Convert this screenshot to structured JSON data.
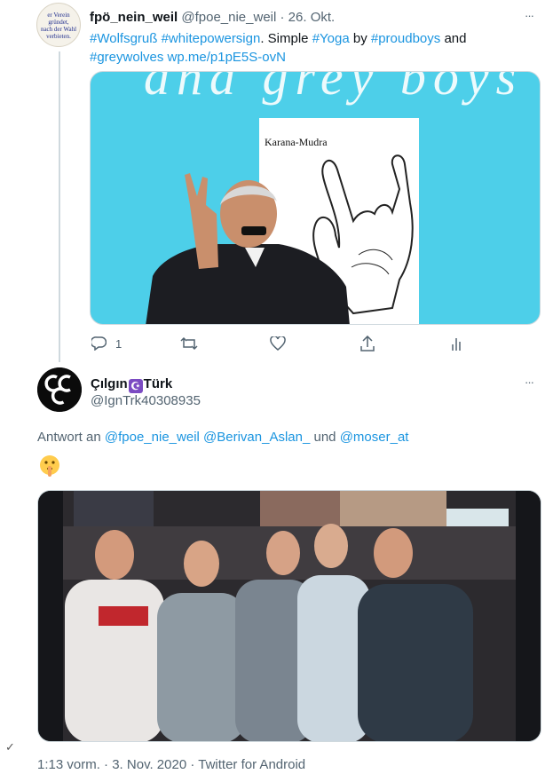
{
  "tweet1": {
    "avatar_lines": [
      "er Verein",
      "gründet,",
      "nach der Wahl",
      "verbieten."
    ],
    "display_name": "fpö_nein_weil",
    "handle": "@fpoe_nie_weil",
    "separator": "·",
    "date": "26. Okt.",
    "more_icon": "···",
    "text_parts": [
      {
        "t": "#Wolfsgruß",
        "link": true
      },
      {
        "t": " ",
        "link": false
      },
      {
        "t": "#whitepowersign",
        "link": true
      },
      {
        "t": ". Simple ",
        "link": false
      },
      {
        "t": "#Yoga",
        "link": true
      },
      {
        "t": " by ",
        "link": false
      },
      {
        "t": "#proudboys",
        "link": true
      },
      {
        "t": " and ",
        "link": false
      },
      {
        "t": "#greywolves",
        "link": true
      },
      {
        "t": " ",
        "link": false
      },
      {
        "t": "wp.me/p1pE5S-ovN",
        "link": true
      }
    ],
    "media": {
      "overlay_text": "and grey boys",
      "card_caption": "Karana-Mudra",
      "background_color": "#4dcfe9"
    },
    "actions": {
      "reply_icon": "reply-icon",
      "reply_count": "1",
      "retweet_icon": "retweet-icon",
      "like_icon": "heart-icon",
      "share_icon": "share-icon",
      "analytics_icon": "analytics-icon"
    }
  },
  "tweet2": {
    "display_name_pre": "Çılgın",
    "display_name_emoji": "☪",
    "display_name_post": "Türk",
    "handle": "@IgnTrk40308935",
    "more_icon": "···",
    "reply_label": "Antwort an",
    "reply_to": [
      "@fpoe_nie_weil",
      "@Berivan_Aslan_"
    ],
    "reply_conjunction": "und",
    "reply_last": "@moser_at",
    "emoji": "shushing-face",
    "timestamp": "1:13 vorm.",
    "date": "3. Nov. 2020",
    "source": "Twitter for Android"
  },
  "colors": {
    "accent": "#1b95e0",
    "secondary_text": "#536471",
    "emoji_purple": "#7b4bc2"
  }
}
